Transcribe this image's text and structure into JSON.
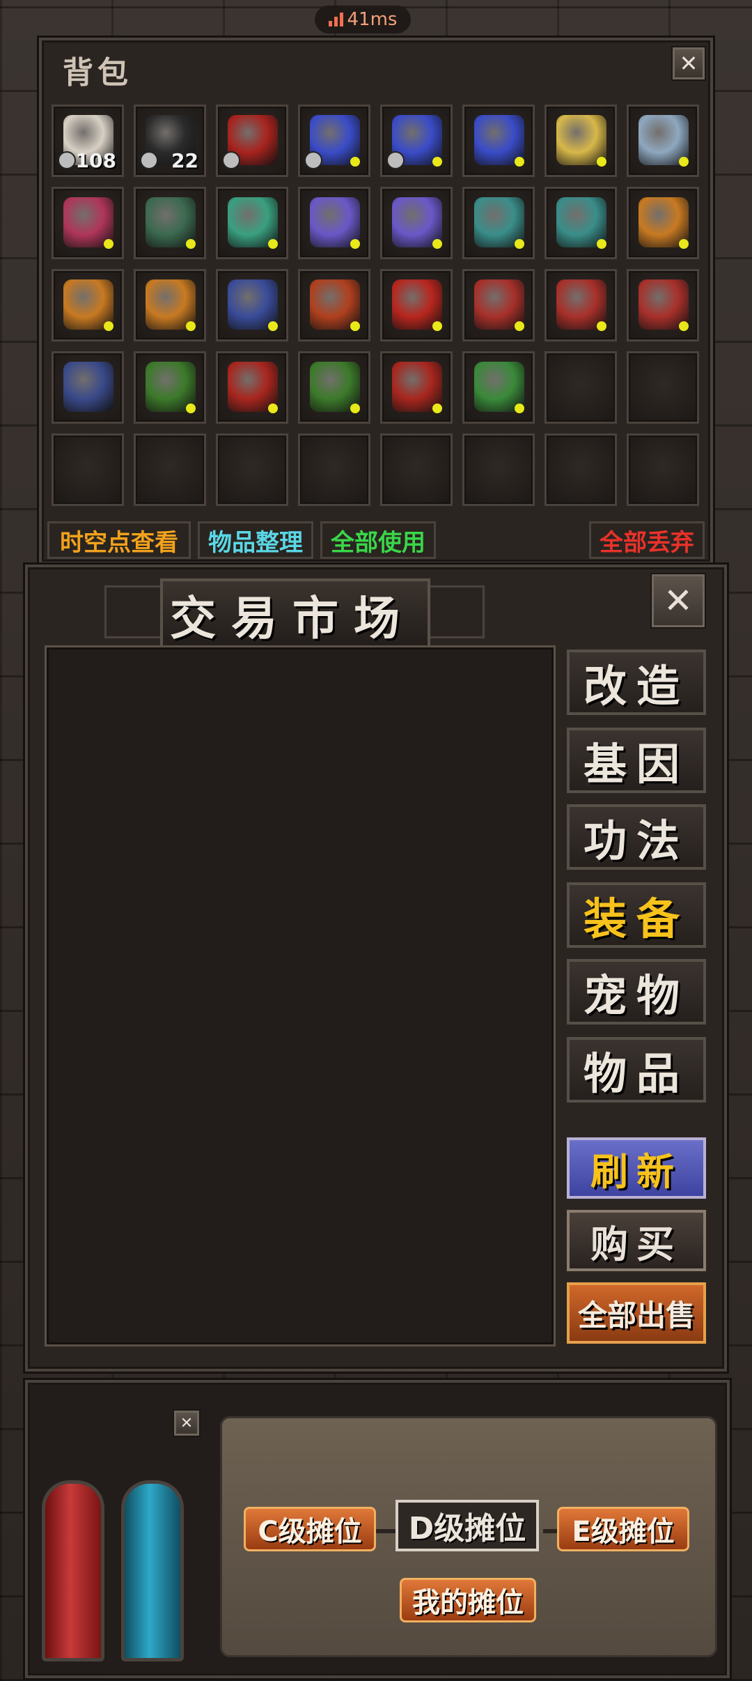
{
  "status": {
    "ping": "41ms"
  },
  "bag": {
    "title": "背包",
    "close": "✕",
    "rows": [
      [
        {
          "color": "#d8d0c4",
          "qty": "108",
          "lock": true
        },
        {
          "color": "#2a2a2a",
          "qty": "22",
          "lock": true
        },
        {
          "color": "#a8231e",
          "lock": true
        },
        {
          "color": "#3a4cc8",
          "lock": true,
          "dot": true
        },
        {
          "color": "#3a4cc8",
          "lock": true,
          "dot": true
        },
        {
          "color": "#3a4cc8",
          "dot": true
        },
        {
          "color": "#d8b84a",
          "dot": true
        },
        {
          "color": "#8fa8c0",
          "dot": true
        }
      ],
      [
        {
          "color": "#b0365a",
          "dot": true
        },
        {
          "color": "#3c6a50",
          "dot": true
        },
        {
          "color": "#3aa080",
          "dot": true
        },
        {
          "color": "#6a58c8",
          "dot": true
        },
        {
          "color": "#6a58c8",
          "dot": true
        },
        {
          "color": "#3a8e8a",
          "dot": true
        },
        {
          "color": "#3a8e8a",
          "dot": true
        },
        {
          "color": "#c87a22",
          "dot": true
        }
      ],
      [
        {
          "color": "#c87a22",
          "dot": true
        },
        {
          "color": "#c87a22",
          "dot": true
        },
        {
          "color": "#3a4c9a",
          "dot": true
        },
        {
          "color": "#b0401e",
          "dot": true
        },
        {
          "color": "#b8261e",
          "dot": true
        },
        {
          "color": "#a8302a",
          "dot": true
        },
        {
          "color": "#a8302a",
          "dot": true
        },
        {
          "color": "#a8302a",
          "dot": true
        }
      ],
      [
        {
          "color": "#3a4a8a"
        },
        {
          "color": "#3c7a2a",
          "dot": true
        },
        {
          "color": "#a8261e",
          "dot": true
        },
        {
          "color": "#3c7a2a",
          "dot": true
        },
        {
          "color": "#a8261e",
          "dot": true
        },
        {
          "color": "#3a8a3a",
          "dot": true
        },
        {},
        {}
      ],
      [
        {},
        {},
        {},
        {},
        {},
        {},
        {},
        {}
      ]
    ],
    "buttons": {
      "spacetime": {
        "label": "时空点查看",
        "color": "#f2a21c"
      },
      "sort": {
        "label": "物品整理",
        "color": "#5ad7e6"
      },
      "use_all": {
        "label": "全部使用",
        "color": "#3ad64a"
      },
      "discard_all": {
        "label": "全部丢弃",
        "color": "#e8322a"
      }
    }
  },
  "market": {
    "title": "交易市场",
    "close": "✕",
    "tabs": [
      "改造",
      "基因",
      "功法",
      "装备",
      "宠物",
      "物品"
    ],
    "active_tab": "装备",
    "refresh": "刷新",
    "buy": "购买",
    "sell_all": "全部出售"
  },
  "stall": {
    "close": "✕",
    "c_stall": "C级摊位",
    "d_stall": "D级摊位",
    "e_stall": "E级摊位",
    "my_stall": "我的摊位"
  }
}
